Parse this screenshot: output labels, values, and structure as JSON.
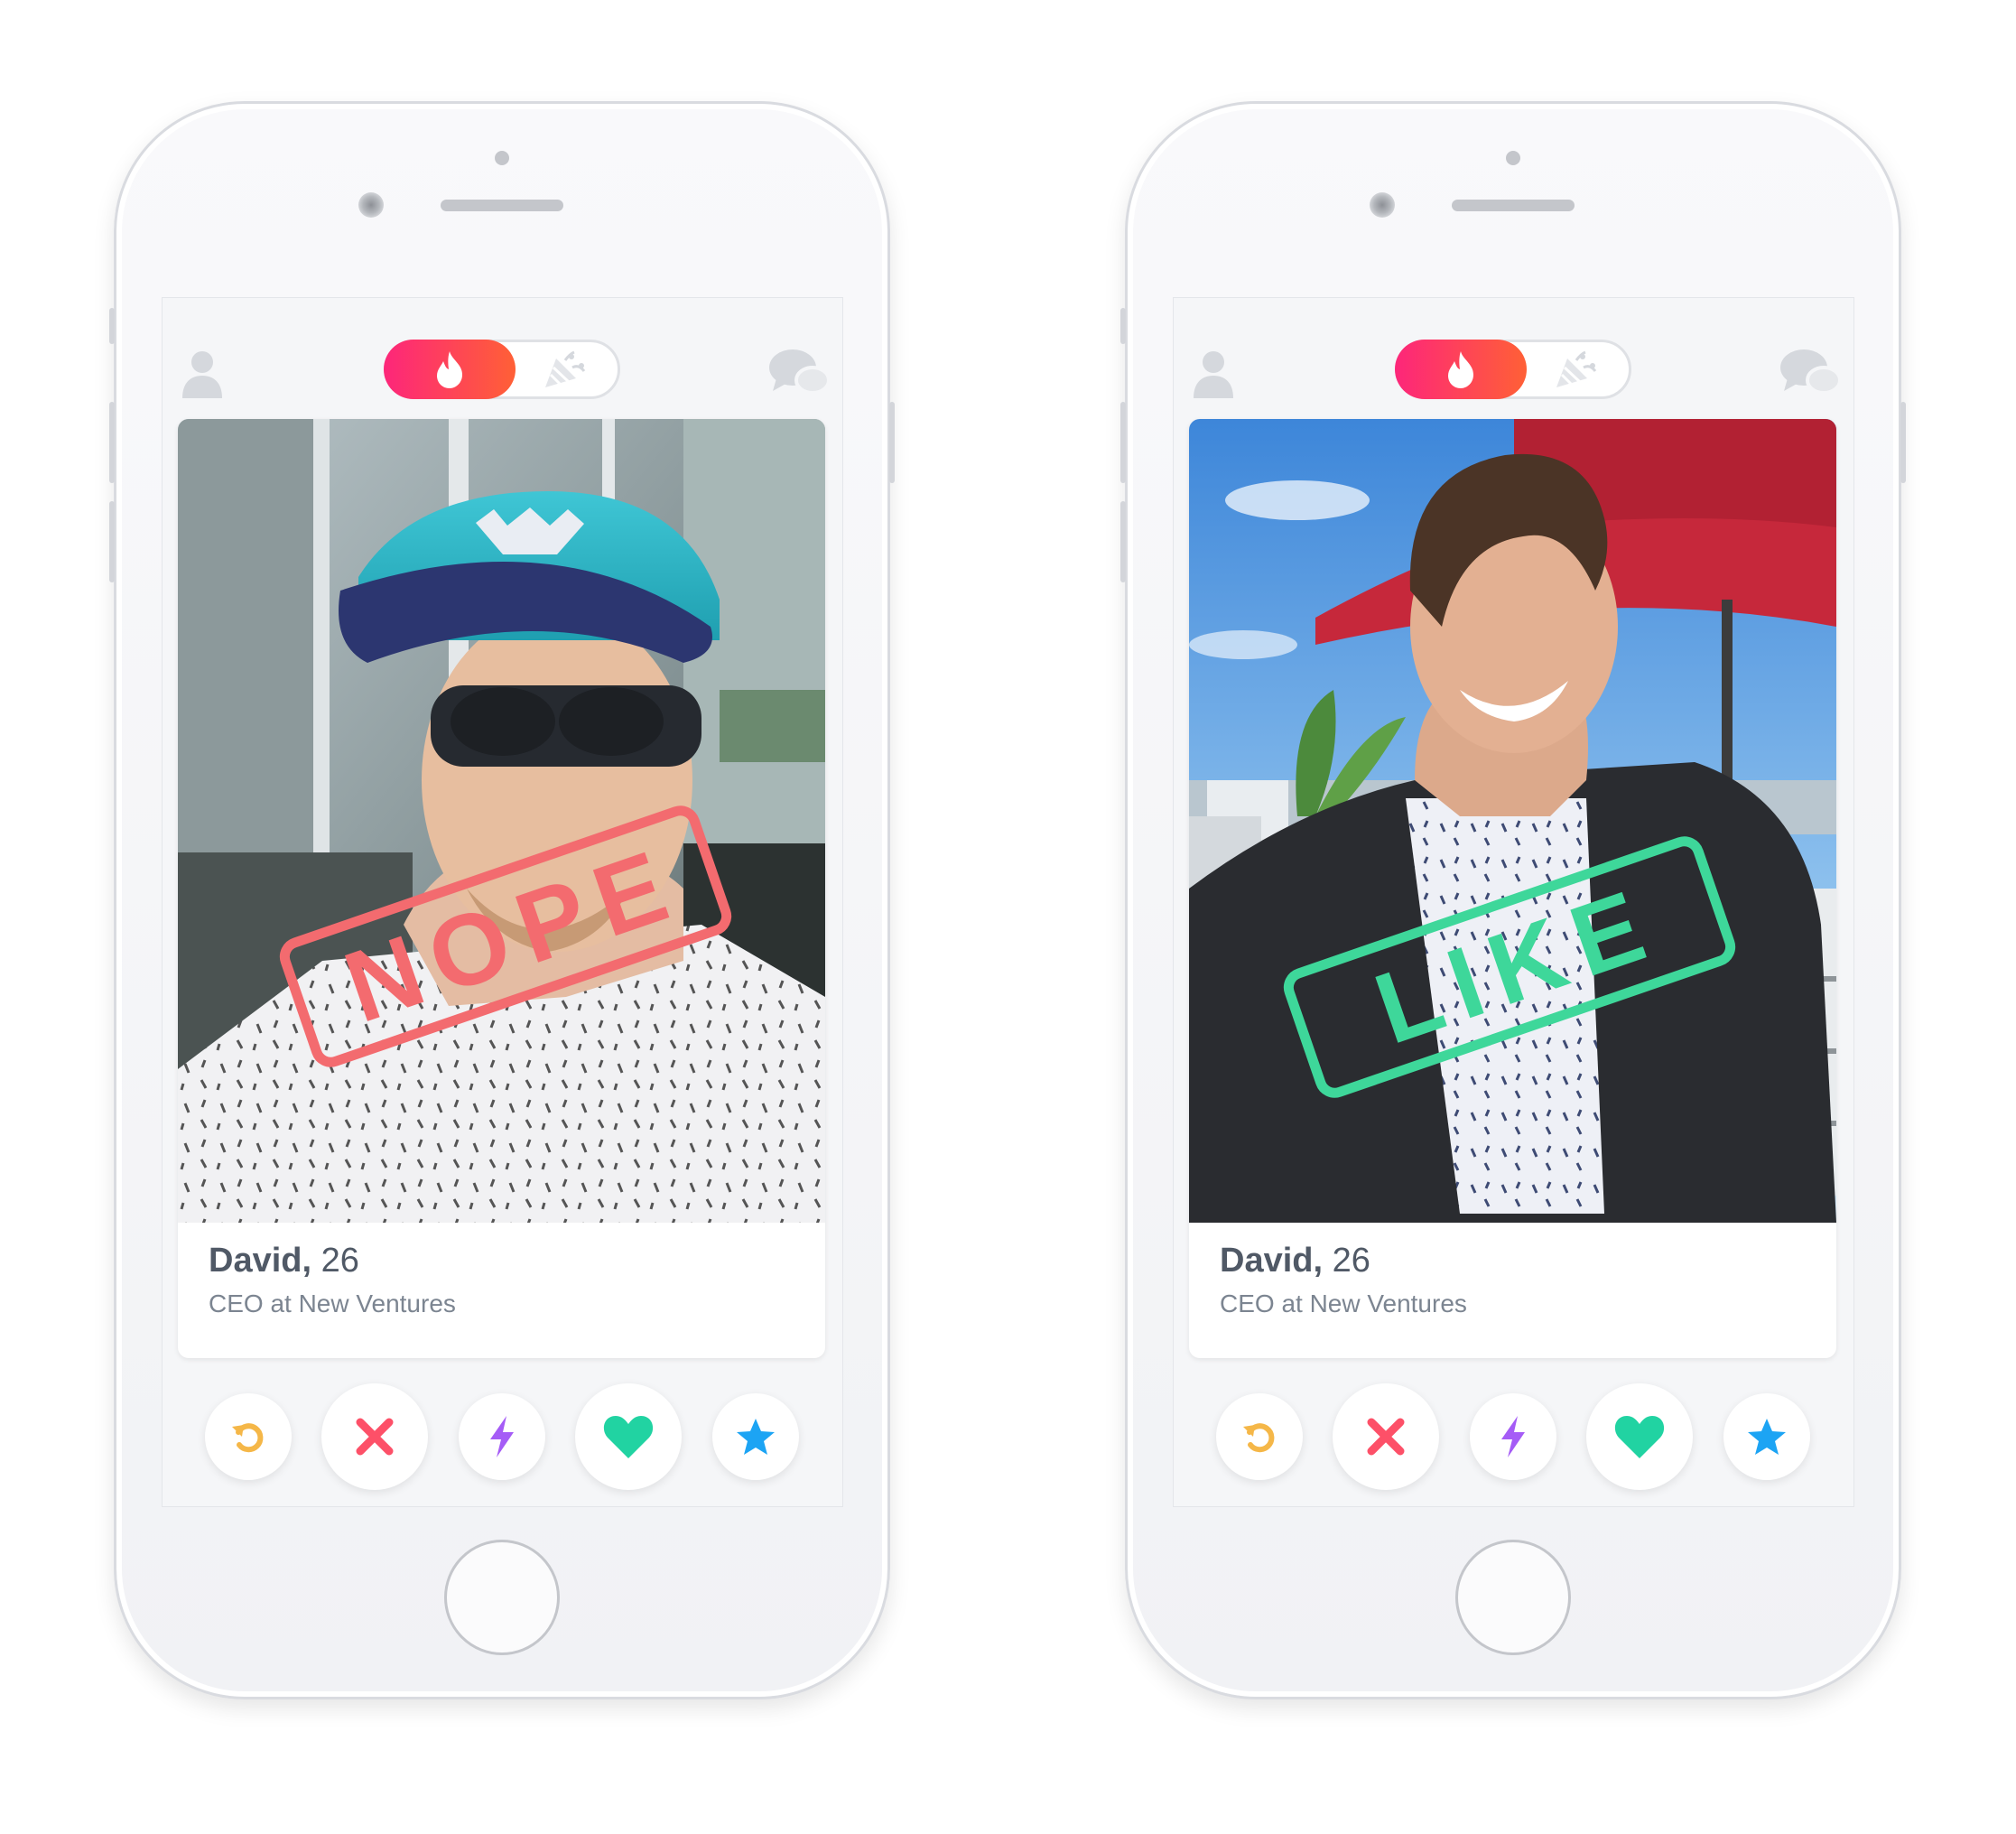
{
  "phones": [
    {
      "id": "left",
      "swipe_stamp": "NOPE",
      "stamp_color": "#f36b6f",
      "profile": {
        "name": "David,",
        "age": "26",
        "job": "CEO at New Ventures"
      }
    },
    {
      "id": "right",
      "swipe_stamp": "LIKE",
      "stamp_color": "#3ed79a",
      "profile": {
        "name": "David,",
        "age": "26",
        "job": "CEO at New Ventures"
      }
    }
  ],
  "colors": {
    "brand_gradient_start": "#fd267a",
    "brand_gradient_end": "#ff6036",
    "rewind": "#f5b748",
    "nope": "#fd5068",
    "boost": "#a55cf6",
    "like": "#21d3a2",
    "super_like": "#1ca4f4"
  },
  "icons": {
    "top_left": "profile-icon",
    "toggle_on": "flame-icon",
    "toggle_off": "party-icon",
    "top_right": "chat-icon",
    "actions": [
      "rewind-icon",
      "nope-x-icon",
      "boost-bolt-icon",
      "like-heart-icon",
      "super-like-star-icon"
    ]
  }
}
